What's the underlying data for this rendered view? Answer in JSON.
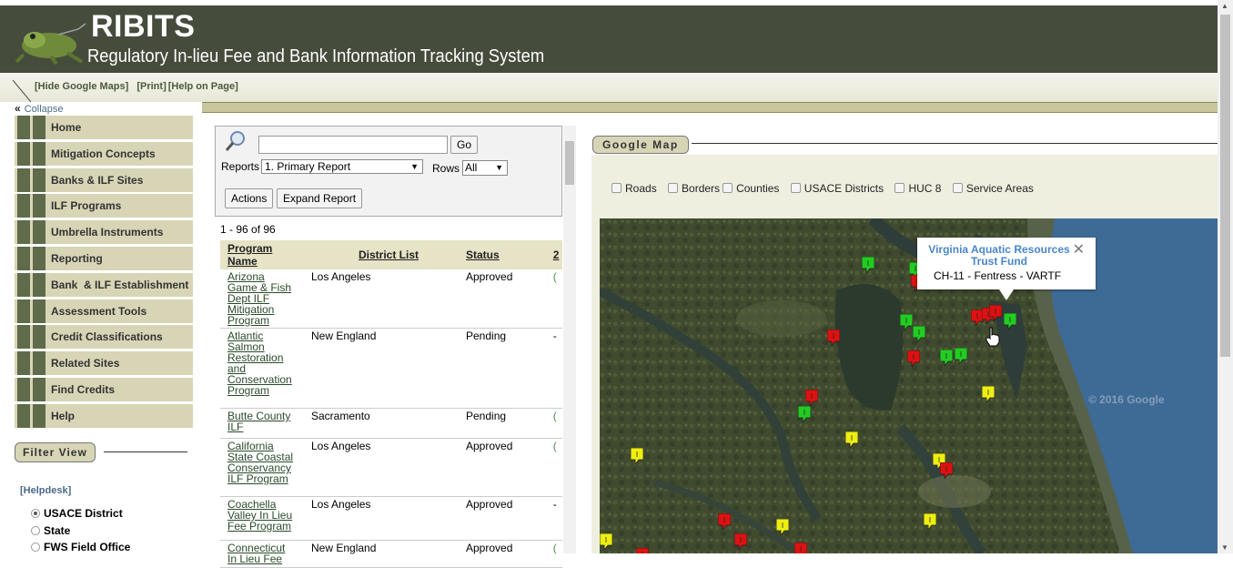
{
  "header": {
    "title": "RIBITS",
    "subtitle": "Regulatory In-lieu Fee and Bank Information Tracking System"
  },
  "linkbar": {
    "hide_maps": "[Hide Google Maps]",
    "print": "[Print]",
    "help": "[Help on Page]"
  },
  "sidebar": {
    "collapse_label": "Collapse",
    "items": [
      {
        "label": "Home"
      },
      {
        "label": "Mitigation Concepts"
      },
      {
        "label": "Banks & ILF Sites"
      },
      {
        "label": "ILF Programs"
      },
      {
        "label": "Umbrella Instruments"
      },
      {
        "label": "Reporting"
      },
      {
        "label": "Bank  & ILF Establishment"
      },
      {
        "label": "Assessment Tools"
      },
      {
        "label": "Credit Classifications"
      },
      {
        "label": "Related Sites"
      },
      {
        "label": "Find Credits"
      },
      {
        "label": "Help"
      }
    ],
    "filter_title": "Filter View",
    "helpdesk": "[Helpdesk]",
    "radios": [
      {
        "label": "USACE District",
        "checked": true
      },
      {
        "label": "State",
        "checked": false
      },
      {
        "label": "FWS Field Office",
        "checked": false
      }
    ]
  },
  "report": {
    "search_value": "",
    "go_label": "Go",
    "reports_label": "Reports",
    "report_selected": "1. Primary Report",
    "rows_label": "Rows",
    "rows_selected": "All",
    "actions_label": "Actions",
    "expand_label": "Expand Report",
    "count": "1 - 96 of 96",
    "columns": [
      "Program Name",
      "District List",
      "Status",
      "2"
    ],
    "rows": [
      {
        "name": "Arizona Game & Fish Dept ILF Mitigation Program",
        "district": "Los Angeles",
        "status": "Approved",
        "extra": "("
      },
      {
        "name": "Atlantic Salmon Restoration and Conservation Program",
        "district": "New England",
        "status": "Pending",
        "extra": "-"
      },
      {
        "name": "Butte County ILF",
        "district": "Sacramento",
        "status": "Pending",
        "extra": "("
      },
      {
        "name": "California State Coastal Conservancy ILF Program",
        "district": "Los Angeles",
        "status": "Approved",
        "extra": "("
      },
      {
        "name": "Coachella Valley In Lieu Fee Program",
        "district": "Los Angeles",
        "status": "Approved",
        "extra": "-"
      },
      {
        "name": "Connecticut In Lieu Fee",
        "district": "New England",
        "status": "Approved",
        "extra": "("
      }
    ]
  },
  "map": {
    "section_title": "Google Map",
    "layers": [
      "Roads",
      "Borders",
      "Counties",
      "USACE Districts",
      "HUC 8",
      "Service Areas"
    ],
    "watermark": "© 2016 Google",
    "info": {
      "title": "Virginia Aquatic Resources Trust Fund",
      "subtitle": "CH-11 - Fentress - VARTF"
    },
    "marker_colors": {
      "green": "#22cc22",
      "red": "#dd1111",
      "yellow": "#eeee11"
    }
  }
}
